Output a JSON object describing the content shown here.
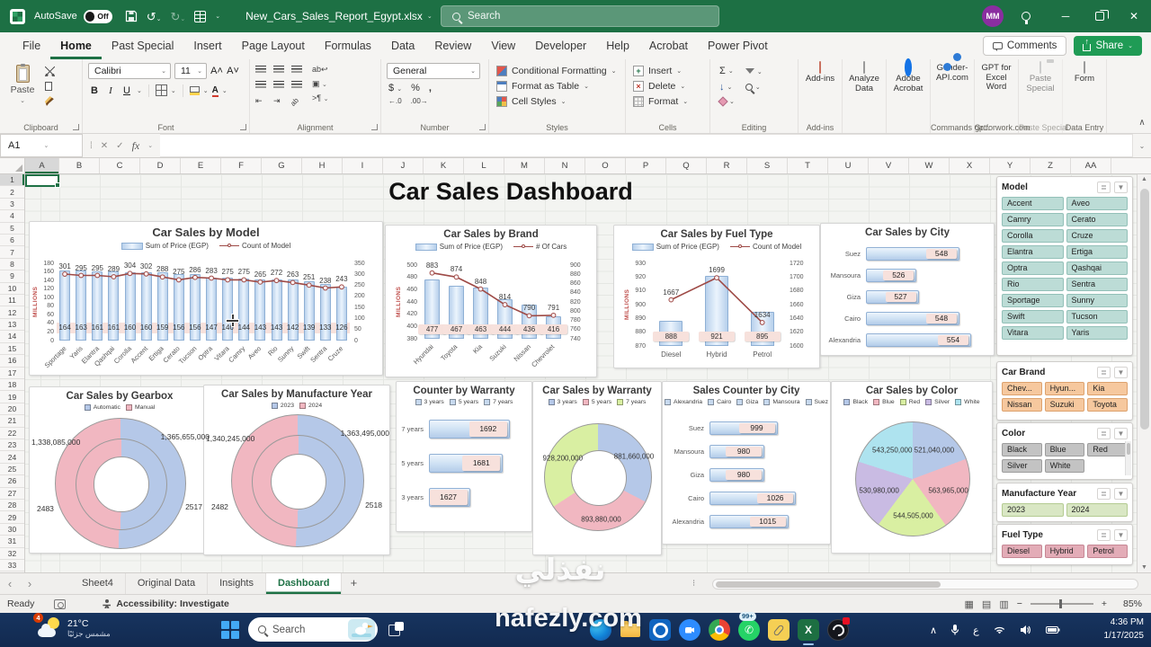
{
  "titlebar": {
    "autosave_label": "AutoSave",
    "autosave_state": "Off",
    "filename": "New_Cars_Sales_Report_Egypt.xlsx",
    "search_placeholder": "Search",
    "user_initials": "MM"
  },
  "menu": {
    "tabs": [
      "File",
      "Home",
      "Past Special",
      "Insert",
      "Page Layout",
      "Formulas",
      "Data",
      "Review",
      "View",
      "Developer",
      "Help",
      "Acrobat",
      "Power Pivot"
    ],
    "active": "Home",
    "comments_label": "Comments",
    "share_label": "Share"
  },
  "ribbon": {
    "paste": "Paste",
    "font_name": "Calibri",
    "font_size": "11",
    "bold": "B",
    "italic": "I",
    "underline": "U",
    "number_format": "General",
    "currency": "$",
    "percent": "%",
    "comma": ",",
    "sum": "Σ",
    "styles": [
      "Conditional Formatting",
      "Format as Table",
      "Cell Styles"
    ],
    "cells": [
      "Insert",
      "Delete",
      "Format"
    ],
    "group_labels": [
      "Clipboard",
      "Font",
      "Alignment",
      "Number",
      "Styles",
      "Cells",
      "Editing"
    ],
    "addins": [
      {
        "label": "Add-ins",
        "group": "Add-ins"
      },
      {
        "label": "Analyze Data",
        "group": ""
      },
      {
        "label": "Adobe Acrobat",
        "group": ""
      },
      {
        "label": "Gender-API.com",
        "group": "Commands Gr..."
      },
      {
        "label": "GPT for Excel Word",
        "group": "gptforwork.com"
      },
      {
        "label": "Paste Special",
        "group": "Paste Special"
      },
      {
        "label": "Form",
        "group": "Data Entry"
      }
    ]
  },
  "formula_bar": {
    "name_box": "A1",
    "fx": "fx"
  },
  "grid": {
    "columns": [
      "A",
      "B",
      "C",
      "D",
      "E",
      "F",
      "G",
      "H",
      "I",
      "J",
      "K",
      "L",
      "M",
      "N",
      "O",
      "P",
      "Q",
      "R",
      "S",
      "T",
      "U",
      "V",
      "W",
      "X",
      "Y",
      "Z",
      "AA"
    ],
    "rows": 33,
    "selected_cell": "A1"
  },
  "dashboard": {
    "title": "Car Sales Dashboard"
  },
  "chart_data": [
    {
      "id": "model",
      "type": "combo",
      "title": "Car Sales by Model",
      "legend": [
        "Sum of Price (EGP)",
        "Count of Model"
      ],
      "ylabel": "MILLIONS",
      "categories": [
        "Sportage",
        "Yaris",
        "Elantra",
        "Qashqai",
        "Corolla",
        "Accent",
        "Ertiga",
        "Cerato",
        "Tucson",
        "Optra",
        "Vitara",
        "Camry",
        "Aveo",
        "Rio",
        "Sunny",
        "Swift",
        "Sentra",
        "Cruze"
      ],
      "bars": [
        164,
        163,
        161,
        161,
        160,
        160,
        159,
        156,
        156,
        147,
        146,
        144,
        143,
        143,
        142,
        139,
        133,
        126
      ],
      "line": [
        301,
        295,
        295,
        289,
        304,
        302,
        288,
        275,
        286,
        283,
        275,
        275,
        265,
        272,
        263,
        251,
        238,
        243
      ],
      "left_axis": {
        "min": 0,
        "max": 180,
        "step": 20
      },
      "right_axis": {
        "min": 0,
        "max": 350,
        "step": 50
      }
    },
    {
      "id": "brand",
      "type": "combo",
      "title": "Car Sales by Brand",
      "legend": [
        "Sum of Price (EGP)",
        "# Of Cars"
      ],
      "ylabel": "MILLIONS",
      "categories": [
        "Hyundai",
        "Toyota",
        "Kia",
        "Suzuki",
        "Nissan",
        "Chevrolet"
      ],
      "bars": [
        477,
        467,
        463,
        444,
        436,
        416
      ],
      "line": [
        883,
        874,
        848,
        814,
        790,
        791
      ],
      "left_axis": {
        "min": 380,
        "max": 500,
        "step": 20
      },
      "right_axis": {
        "min": 740,
        "max": 900,
        "step": 20
      }
    },
    {
      "id": "fuel",
      "type": "combo",
      "title": "Car Sales by Fuel Type",
      "legend": [
        "Sum of Price (EGP)",
        "Count of Model"
      ],
      "ylabel": "MILLIONS",
      "categories": [
        "Diesel",
        "Hybrid",
        "Petrol"
      ],
      "bars": [
        888,
        921,
        895
      ],
      "line": [
        1667,
        1699,
        1634
      ],
      "left_axis": {
        "min": 870,
        "max": 930,
        "step": 10
      },
      "right_axis": {
        "min": 1600,
        "max": 1720,
        "step": 20
      }
    },
    {
      "id": "city_sales",
      "type": "hbar",
      "title": "Car Sales by City",
      "categories": [
        "Suez",
        "Mansoura",
        "Giza",
        "Cairo",
        "Alexandria"
      ],
      "values": [
        548,
        526,
        527,
        548,
        554
      ],
      "axis_min": 500,
      "axis_max": 560
    },
    {
      "id": "gearbox",
      "type": "double_donut",
      "title": "Car Sales by Gearbox",
      "legend": [
        "Automatic",
        "Manual"
      ],
      "slices": [
        {
          "name": "Automatic",
          "sum": 1365655000,
          "sum_display": "1,365,655,000",
          "count": 2517
        },
        {
          "name": "Manual",
          "sum": 1338085000,
          "sum_display": "1,338,085,000",
          "count": 2483
        }
      ]
    },
    {
      "id": "year",
      "type": "double_donut",
      "title": "Car Sales by Manufacture Year",
      "legend": [
        "2023",
        "2024"
      ],
      "slices": [
        {
          "name": "2023",
          "sum": 1363495000,
          "sum_display": "1,363,495,000",
          "count": 2518
        },
        {
          "name": "2024",
          "sum": 1340245000,
          "sum_display": "1,340,245,000",
          "count": 2482
        }
      ]
    },
    {
      "id": "warranty_count",
      "type": "hbar",
      "title": "Counter by Warranty",
      "legend": [
        "3 years",
        "5 years",
        "7 years"
      ],
      "categories": [
        "7 years",
        "5 years",
        "3 years"
      ],
      "values": [
        1692,
        1681,
        1627
      ],
      "axis_min": 1560,
      "axis_max": 1710
    },
    {
      "id": "warranty_sales",
      "type": "donut",
      "title": "Car Sales by Warranty",
      "legend": [
        "3 years",
        "5 years",
        "7 years"
      ],
      "slices": [
        {
          "label": "3 years",
          "value": 881660000,
          "display": "881,660,000",
          "color": "#b5c8e8"
        },
        {
          "label": "5 years",
          "value": 893880000,
          "display": "893,880,000",
          "color": "#f1b7c1"
        },
        {
          "label": "7 years",
          "value": 928200000,
          "display": "928,200,000",
          "color": "#d9efa2"
        }
      ]
    },
    {
      "id": "city_count",
      "type": "hbar",
      "title": "Sales Counter by City",
      "legend": [
        "Alexandria",
        "Cairo",
        "Giza",
        "Mansoura",
        "Suez"
      ],
      "categories": [
        "Suez",
        "Mansoura",
        "Giza",
        "Cairo",
        "Alexandria"
      ],
      "values": [
        999,
        980,
        980,
        1026,
        1015
      ],
      "axis_min": 900,
      "axis_max": 1060
    },
    {
      "id": "color",
      "type": "pie",
      "title": "Car Sales by Color",
      "legend": [
        "Black",
        "Blue",
        "Red",
        "Silver",
        "White"
      ],
      "slices": [
        {
          "label": "Black",
          "value": 521040000,
          "display": "521,040,000",
          "color": "#b5c8e8"
        },
        {
          "label": "Blue",
          "value": 563965000,
          "display": "563,965,000",
          "color": "#f1b7c1"
        },
        {
          "label": "Red",
          "value": 544505000,
          "display": "544,505,000",
          "color": "#d9efa2"
        },
        {
          "label": "Silver",
          "value": 530980000,
          "display": "530,980,000",
          "color": "#c9bbe3"
        },
        {
          "label": "White",
          "value": 543250000,
          "display": "543,250,000",
          "color": "#aee3ef"
        }
      ]
    }
  ],
  "slicers": [
    {
      "id": "model",
      "title": "Model",
      "cols": 2,
      "items": [
        "Accent",
        "Aveo",
        "Camry",
        "Cerato",
        "Corolla",
        "Cruze",
        "Elantra",
        "Ertiga",
        "Optra",
        "Qashqai",
        "Rio",
        "Sentra",
        "Sportage",
        "Sunny",
        "Swift",
        "Tucson",
        "Vitara",
        "Yaris"
      ]
    },
    {
      "id": "brand",
      "title": "Car Brand",
      "cols": 3,
      "items": [
        "Chev...",
        "Hyun...",
        "Kia",
        "Nissan",
        "Suzuki",
        "Toyota"
      ]
    },
    {
      "id": "color",
      "title": "Color",
      "cols": 3,
      "scrollbar": true,
      "items": [
        "Black",
        "Blue",
        "Red",
        "Silver",
        "White"
      ]
    },
    {
      "id": "year",
      "title": "Manufacture Year",
      "cols": 2,
      "items": [
        "2023",
        "2024"
      ]
    },
    {
      "id": "fuel",
      "title": "Fuel Type",
      "cols": 3,
      "items": [
        "Diesel",
        "Hybrid",
        "Petrol"
      ]
    }
  ],
  "sheet_tabs": {
    "tabs": [
      "Sheet4",
      "Original Data",
      "Insights",
      "Dashboard"
    ],
    "active": "Dashboard",
    "add_label": "+"
  },
  "status_bar": {
    "ready": "Ready",
    "accessibility": "Accessibility: Investigate",
    "zoom_level": "85%"
  },
  "taskbar": {
    "weather_temp": "21°C",
    "weather_condition": "مشمس جزئيًا",
    "weather_badge": "4",
    "search_placeholder": "Search",
    "whatsapp_badge": "99+",
    "lang_indicator": "ع",
    "time": "4:36 PM",
    "date": "1/17/2025"
  },
  "watermark": {
    "line1": "نفذلي",
    "line2": "nafezly.com"
  },
  "palette": {
    "bar_border": "#8fb0d5",
    "line": "#9e4a46",
    "label_bg": "#f7e1dc",
    "donut_blue": "#b5c8e8",
    "donut_pink": "#f1b7c1",
    "legend_blue": "#c7d9ee"
  }
}
